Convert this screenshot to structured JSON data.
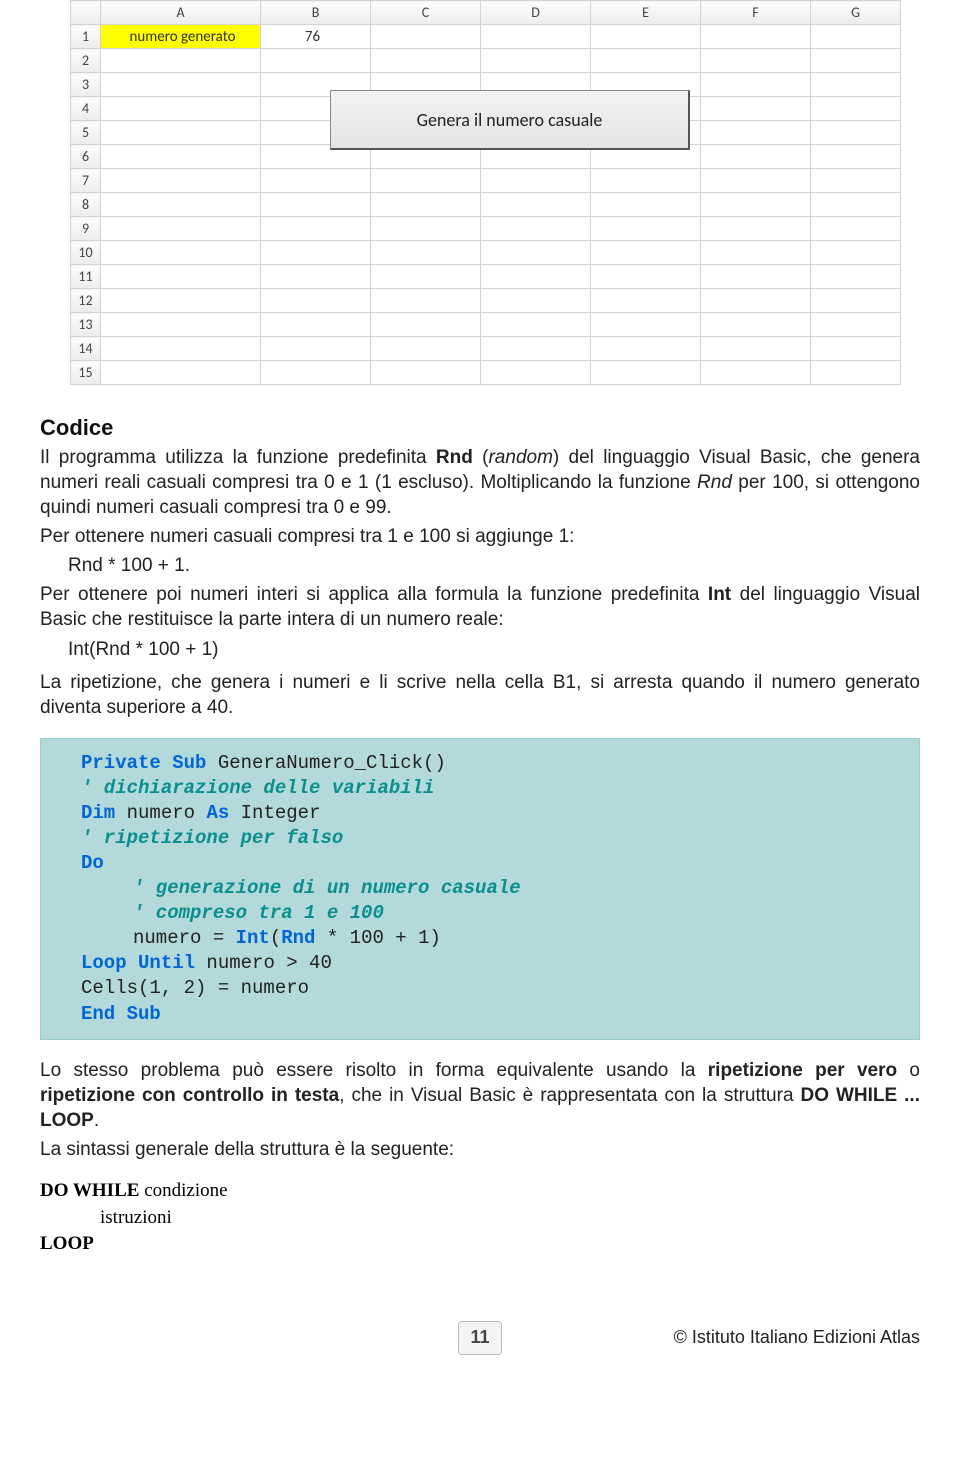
{
  "spreadsheet": {
    "columns": [
      "A",
      "B",
      "C",
      "D",
      "E",
      "F",
      "G"
    ],
    "rows": [
      "1",
      "2",
      "3",
      "4",
      "5",
      "6",
      "7",
      "8",
      "9",
      "10",
      "11",
      "12",
      "13",
      "14",
      "15"
    ],
    "a1": "numero generato",
    "b1": "76",
    "button_label": "Genera il numero casuale"
  },
  "heading_codice": "Codice",
  "para1_a": "Il programma utilizza la funzione predefinita ",
  "para1_b": "Rnd",
  "para1_c": " (",
  "para1_d": "random",
  "para1_e": ") del linguaggio Visual Basic, che genera numeri reali casuali compresi tra 0 e 1 (1 escluso). Moltiplicando la funzione ",
  "para1_f": "Rnd",
  "para1_g": " per 100, si ottengono quindi numeri casuali compresi tra 0 e 99.",
  "para2": "Per ottenere numeri casuali compresi tra 1 e 100 si aggiunge 1:",
  "formula1": "Rnd * 100 + 1.",
  "para3_a": "Per ottenere poi numeri interi si applica alla formula la funzione predefinita ",
  "para3_b": "Int",
  "para3_c": " del linguaggio Visual Basic che restituisce la parte intera di un numero reale:",
  "formula2": "Int(Rnd * 100 + 1)",
  "para4": "La ripetizione, che genera i numeri e li scrive nella cella B1, si arresta quando il numero generato diventa superiore a 40.",
  "code": {
    "l1a": "Private Sub",
    "l1b": " GeneraNumero_Click()",
    "l2": "' dichiarazione delle variabili",
    "l3a": "Dim",
    "l3b": " numero ",
    "l3c": "As",
    "l3d": " Integer",
    "l4": "' ripetizione per falso",
    "l5": "Do",
    "l6": "' generazione di un numero casuale",
    "l7": "' compreso tra 1 e 100",
    "l8a": "numero = ",
    "l8b": "Int",
    "l8c": "(",
    "l8d": "Rnd",
    "l8e": " * 100 + 1)",
    "l9a": "Loop Until",
    "l9b": " numero > 40",
    "l10": "Cells(1, 2) = numero",
    "l11": "End Sub"
  },
  "para5_a": "Lo stesso problema può essere risolto in forma equivalente usando la ",
  "para5_b": "ripetizione per vero",
  "para5_c": " o ",
  "para5_d": "ripetizione con controllo in testa",
  "para5_e": ", che in Visual Basic è rappresentata con la struttura ",
  "para5_f": "DO WHILE ... LOOP",
  "para5_g": ".",
  "para6": "La sintassi generale della struttura è la seguente:",
  "syntax": {
    "l1a": "DO WHILE",
    "l1b": " condizione",
    "l2": "istruzioni",
    "l3": "LOOP"
  },
  "page_number": "11",
  "copyright": "© Istituto Italiano Edizioni Atlas"
}
